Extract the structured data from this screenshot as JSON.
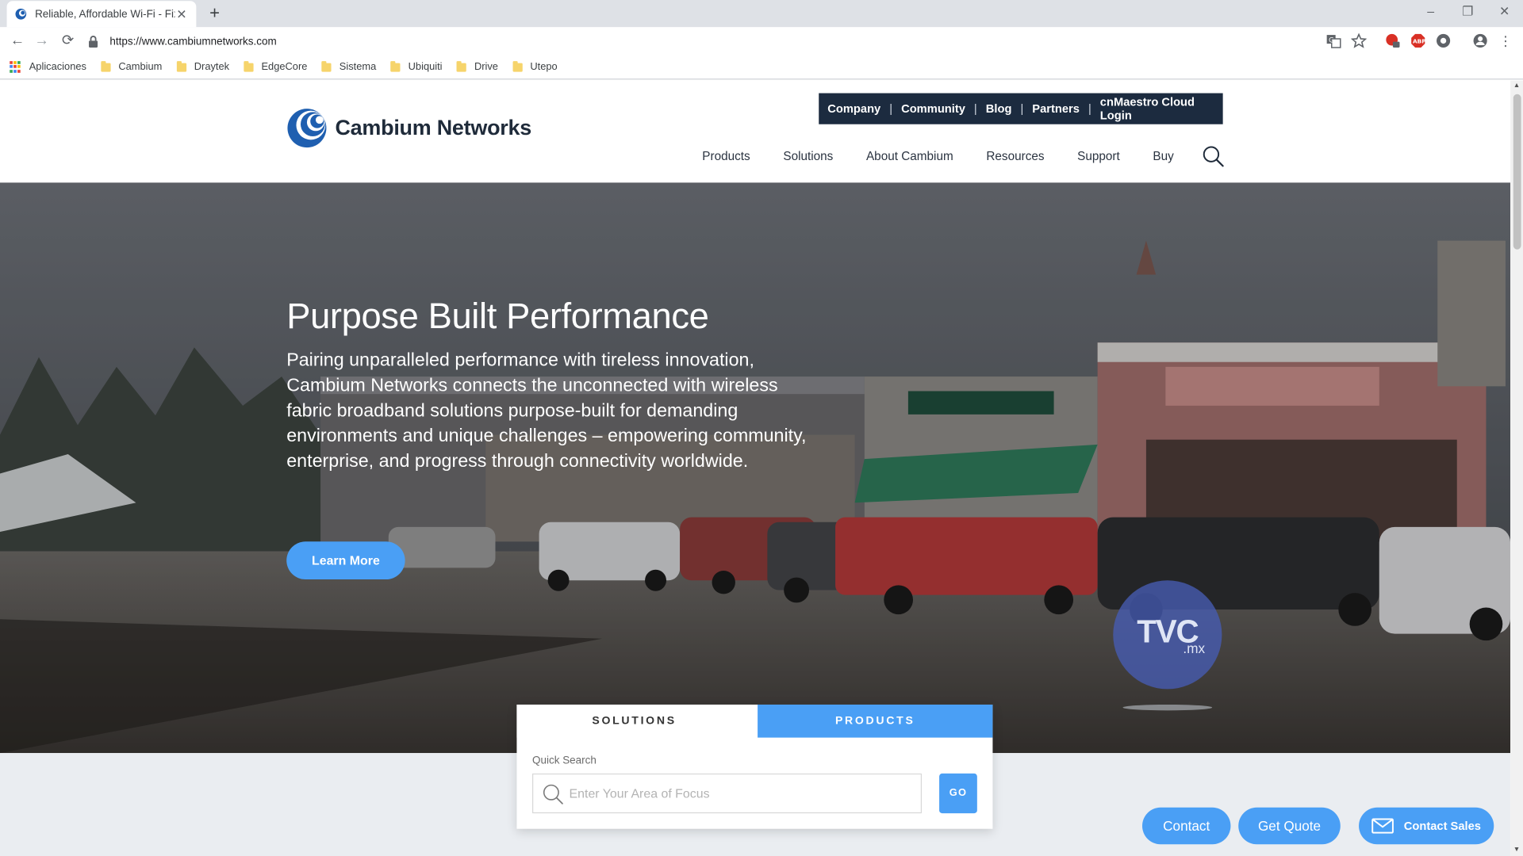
{
  "browser": {
    "tab_title": "Reliable, Affordable Wi-Fi - Fixed",
    "tab_close": "✕",
    "new_tab": "+",
    "url": "https://www.cambiumnetworks.com",
    "window_controls": {
      "minimize": "–",
      "restore": "❐",
      "close": "✕"
    },
    "nav": {
      "back": "←",
      "forward": "→",
      "reload": "⟳",
      "more": "⋮"
    },
    "bookmarks": [
      {
        "label": "Aplicaciones",
        "icon": "apps-grid-icon"
      },
      {
        "label": "Cambium",
        "icon": "folder-icon"
      },
      {
        "label": "Draytek",
        "icon": "folder-icon"
      },
      {
        "label": "EdgeCore",
        "icon": "folder-icon"
      },
      {
        "label": "Sistema",
        "icon": "folder-icon"
      },
      {
        "label": "Ubiquiti",
        "icon": "folder-icon"
      },
      {
        "label": "Drive",
        "icon": "folder-icon"
      },
      {
        "label": "Utepo",
        "icon": "folder-icon"
      }
    ]
  },
  "site": {
    "logo_text": "Cambium Networks",
    "utility_nav": [
      "Company",
      "Community",
      "Blog",
      "Partners",
      "cnMaestro Cloud Login"
    ],
    "utility_sep": "|",
    "main_nav": [
      "Products",
      "Solutions",
      "About Cambium",
      "Resources",
      "Support",
      "Buy"
    ]
  },
  "hero": {
    "title": "Purpose Built Performance",
    "text": "Pairing unparalleled performance with tireless innovation, Cambium Networks connects the unconnected with wireless fabric broadband solutions purpose-built for demanding environments and unique challenges – empowering community, enterprise, and progress through connectivity worldwide.",
    "cta": "Learn More",
    "watermark_big": "TVC",
    "watermark_small": ".mx"
  },
  "quick_search": {
    "tab_solutions": "SOLUTIONS",
    "tab_products": "PRODUCTS",
    "label": "Quick Search",
    "placeholder": "Enter Your Area of Focus",
    "value": "",
    "go": "GO"
  },
  "floating": {
    "contact": "Contact",
    "quote": "Get Quote",
    "sales": "Contact Sales"
  },
  "colors": {
    "accent": "#4a9ff5",
    "navy": "#1c2b3f",
    "logo_blue": "#1f5fb0"
  }
}
